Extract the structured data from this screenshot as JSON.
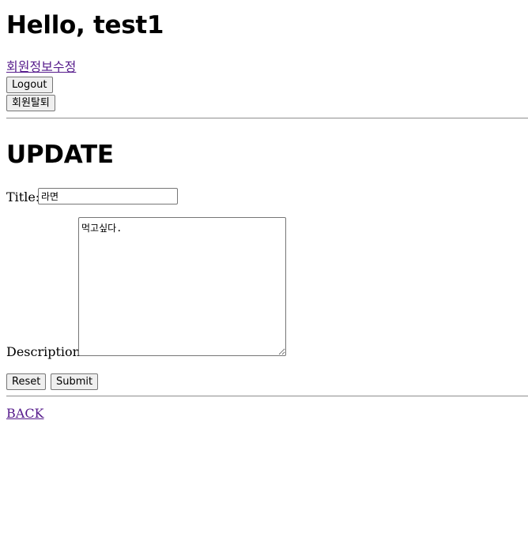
{
  "header": {
    "greeting": "Hello, test1",
    "edit_profile_link": "회원정보수정",
    "logout_button": "Logout",
    "withdraw_button": "회원탈퇴"
  },
  "form": {
    "heading": "UPDATE",
    "title_label": "Title:",
    "title_value": "라면",
    "description_label": "Description:",
    "description_value": "먹고싶다.",
    "reset_button": "Reset",
    "submit_button": "Submit"
  },
  "footer": {
    "back_link": "BACK"
  },
  "colors": {
    "visited_link": "#551a8b",
    "button_bg": "#efefef",
    "border": "#767676"
  }
}
